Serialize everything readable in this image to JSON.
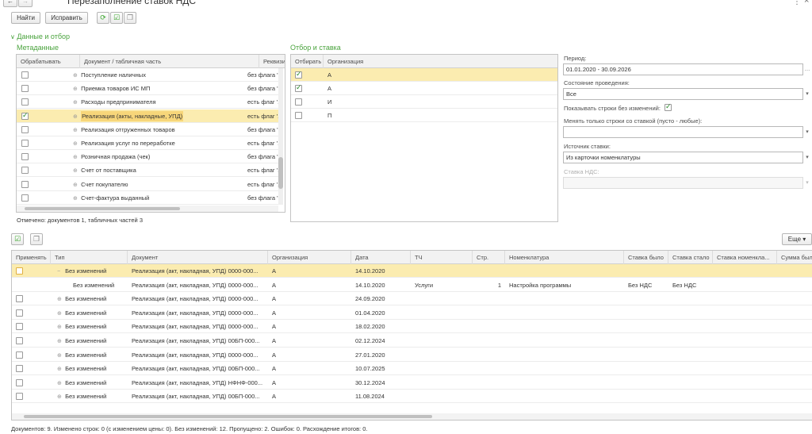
{
  "window": {
    "title": "Перезаполнение ставок НДС",
    "more_menu": "⋮",
    "close": "×"
  },
  "toolbar": {
    "find_label": "Найти",
    "fix_label": "Исправить"
  },
  "data_section": {
    "title": "Данные и отбор"
  },
  "metadata": {
    "title": "Метаданные",
    "columns": [
      "Обрабатывать",
      "Документ / табличная часть",
      "Реквизиты"
    ],
    "rows": [
      {
        "checked": false,
        "doc": "Поступление наличных",
        "req": "без флага '..."
      },
      {
        "checked": false,
        "doc": "Приемка товаров ИС МП",
        "req": "без флага '..."
      },
      {
        "checked": false,
        "doc": "Расходы предпринимателя",
        "req": "есть флаг '..."
      },
      {
        "checked": true,
        "doc": "Реализация (акты, накладные, УПД)",
        "req": "есть флаг '...",
        "selected": true
      },
      {
        "checked": false,
        "doc": "Реализация отгруженных товаров",
        "req": "без флага '..."
      },
      {
        "checked": false,
        "doc": "Реализация услуг по переработке",
        "req": "есть флаг '..."
      },
      {
        "checked": false,
        "doc": "Розничная продажа (чек)",
        "req": "без флага '..."
      },
      {
        "checked": false,
        "doc": "Счет от поставщика",
        "req": "есть флаг '..."
      },
      {
        "checked": false,
        "doc": "Счет покупателю",
        "req": "есть флаг '..."
      },
      {
        "checked": false,
        "doc": "Счет-фактура выданный",
        "req": "без флага '..."
      }
    ],
    "footer": "Отмечено: документов 1, табличных частей 3"
  },
  "filter": {
    "title": "Отбор и ставка",
    "columns": [
      "Отбирать",
      "Организация"
    ],
    "rows": [
      {
        "checked": true,
        "org": "А",
        "selected": true
      },
      {
        "checked": true,
        "org": "А"
      },
      {
        "checked": false,
        "org": "И"
      },
      {
        "checked": false,
        "org": "П"
      }
    ]
  },
  "params": {
    "period_label": "Период:",
    "period_value": "01.01.2020 - 30.09.2026",
    "state_label": "Состояние проведения:",
    "state_value": "Все",
    "show_unchanged_label": "Показывать строки без изменений:",
    "only_rate_label": "Менять только строки со ставкой (пусто - любые):",
    "only_rate_value": "",
    "source_label": "Источник ставки:",
    "source_value": "Из карточки номенклатуры",
    "vat_rate_label": "Ставка НДС:",
    "vat_rate_value": ""
  },
  "results": {
    "more_label": "Еще",
    "columns": [
      "Применять",
      "Тип",
      "Документ",
      "Организация",
      "Дата",
      "ТЧ",
      "Стр.",
      "Номенклатура",
      "Ставка было",
      "Ставка стало",
      "Ставка номенкла...",
      "Сумма был"
    ],
    "rows": [
      {
        "type": "Без изменений",
        "doc": "Реализация (акт, накладная, УПД) 0000-000...",
        "org": "А",
        "date": "14.10.2020",
        "tch": "",
        "line": "",
        "nom": "",
        "was": "",
        "now": "",
        "nomrate": "",
        "sum": "",
        "expand": "−",
        "selected": true
      },
      {
        "type": "Без изменений",
        "doc": "Реализация (акт, накладная, УПД) 0000-000...",
        "org": "А",
        "date": "14.10.2020",
        "tch": "Услуги",
        "line": "1",
        "nom": "Настройка программы",
        "was": "Без НДС",
        "now": "Без НДС",
        "nomrate": "",
        "sum": "",
        "expand": "",
        "child": true
      },
      {
        "type": "Без изменений",
        "doc": "Реализация (акт, накладная, УПД) 0000-000...",
        "org": "А",
        "date": "24.09.2020",
        "tch": "",
        "line": "",
        "nom": "",
        "was": "",
        "now": "",
        "nomrate": "",
        "sum": "",
        "expand": "⊕"
      },
      {
        "type": "Без изменений",
        "doc": "Реализация (акт, накладная, УПД) 0000-000...",
        "org": "А",
        "date": "01.04.2020",
        "tch": "",
        "line": "",
        "nom": "",
        "was": "",
        "now": "",
        "nomrate": "",
        "sum": "",
        "expand": "⊕"
      },
      {
        "type": "Без изменений",
        "doc": "Реализация (акт, накладная, УПД) 0000-000...",
        "org": "А",
        "date": "18.02.2020",
        "tch": "",
        "line": "",
        "nom": "",
        "was": "",
        "now": "",
        "nomrate": "",
        "sum": "",
        "expand": "⊕"
      },
      {
        "type": "Без изменений",
        "doc": "Реализация (акт, накладная, УПД) 00БП-000...",
        "org": "А",
        "date": "02.12.2024",
        "tch": "",
        "line": "",
        "nom": "",
        "was": "",
        "now": "",
        "nomrate": "",
        "sum": "",
        "expand": "⊕"
      },
      {
        "type": "Без изменений",
        "doc": "Реализация (акт, накладная, УПД) 0000-000...",
        "org": "А",
        "date": "27.01.2020",
        "tch": "",
        "line": "",
        "nom": "",
        "was": "",
        "now": "",
        "nomrate": "",
        "sum": "",
        "expand": "⊕"
      },
      {
        "type": "Без изменений",
        "doc": "Реализация (акт, накладная, УПД) 00БП-000...",
        "org": "А",
        "date": "10.07.2025",
        "tch": "",
        "line": "",
        "nom": "",
        "was": "",
        "now": "",
        "nomrate": "",
        "sum": "",
        "expand": "⊕"
      },
      {
        "type": "Без изменений",
        "doc": "Реализация (акт, накладная, УПД) НФНФ-000...",
        "org": "А",
        "date": "30.12.2024",
        "tch": "",
        "line": "",
        "nom": "",
        "was": "",
        "now": "",
        "nomrate": "",
        "sum": "",
        "expand": "⊕"
      },
      {
        "type": "Без изменений",
        "doc": "Реализация (акт, накладная, УПД) 00БП-000...",
        "org": "А",
        "date": "11.08.2024",
        "tch": "",
        "line": "",
        "nom": "",
        "was": "",
        "now": "",
        "nomrate": "",
        "sum": "",
        "expand": "⊕"
      }
    ]
  },
  "status_bar": "Документов: 9. Изменено строк: 0 (с изменением цены: 0). Без изменений: 12. Пропущено: 2. Ошибок: 0. Расхождение итогов: 0."
}
